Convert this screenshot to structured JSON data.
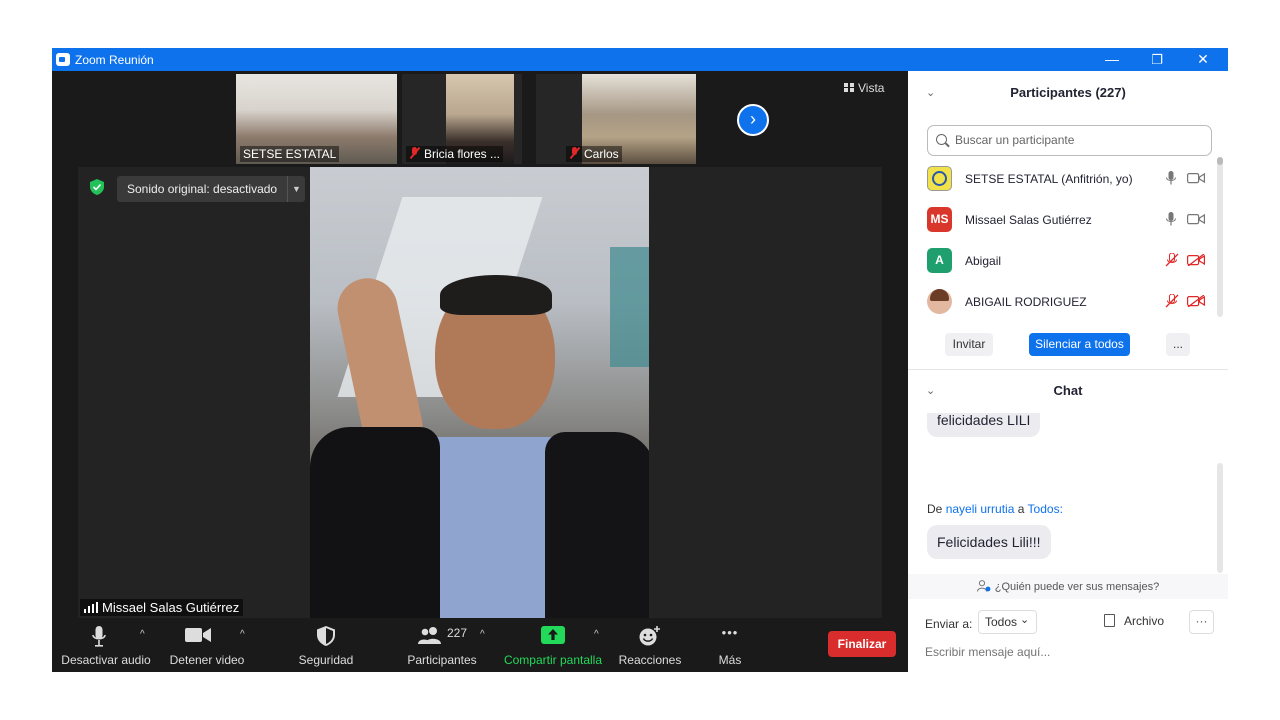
{
  "window": {
    "title": "Zoom Reunión",
    "minimize_glyph": "—",
    "restore_glyph": "❐",
    "close_glyph": "✕"
  },
  "thumbnails": [
    {
      "name": "SETSE ESTATAL",
      "muted": false
    },
    {
      "name": "Bricia flores ...",
      "muted": true
    },
    {
      "name": "Carlos",
      "muted": true
    }
  ],
  "view_label": "Vista",
  "next_glyph": "›",
  "stage": {
    "sound_label": "Sonido original: desactivado",
    "sound_caret": "▼",
    "speaker_name": "Missael Salas Gutiérrez"
  },
  "toolbar": {
    "audio": "Desactivar audio",
    "video": "Detener video",
    "security": "Seguridad",
    "participants": "Participantes",
    "participants_count": "227",
    "share": "Compartir pantalla",
    "reactions": "Reacciones",
    "more": "Más",
    "more_glyph": "•••",
    "caret_glyph": "^",
    "end": "Finalizar"
  },
  "participants_panel": {
    "title": "Participantes (227)",
    "chevron": "⌄",
    "search_placeholder": "Buscar un participante",
    "rows": [
      {
        "initials": "",
        "name": "SETSE ESTATAL (Anfitrión, yo)",
        "mic": "on",
        "cam": "on",
        "avatar_color": "#f2e24a"
      },
      {
        "initials": "MS",
        "name": "Missael Salas Gutiérrez",
        "mic": "on",
        "cam": "on",
        "avatar_color": "#d9372b"
      },
      {
        "initials": "A",
        "name": "Abigail",
        "mic": "off",
        "cam": "off",
        "avatar_color": "#1f9e6e"
      },
      {
        "initials": "",
        "name": "ABIGAIL RODRIGUEZ",
        "mic": "off",
        "cam": "off",
        "avatar_color": "#e3b8a0"
      }
    ],
    "invite": "Invitar",
    "mute_all": "Silenciar a todos",
    "more": "..."
  },
  "chat": {
    "title": "Chat",
    "chevron": "⌄",
    "message1": "felicidades LILI",
    "from_prefix": "De",
    "from_name": "nayeli urrutia",
    "to_word": "a",
    "to_name": "Todos:",
    "message2": "Felicidades Lili!!!",
    "who_can_see": "¿Quién puede ver sus mensajes?",
    "send_to_label": "Enviar a:",
    "send_to_value": "Todos",
    "send_to_caret": "⌄",
    "file_label": "Archivo",
    "more_glyph": "···",
    "input_placeholder": "Escribir mensaje aquí..."
  },
  "colors": {
    "accent": "#0e72ed",
    "danger": "#d92c2c",
    "share_green": "#23d959",
    "background": "#1a1a1a"
  }
}
